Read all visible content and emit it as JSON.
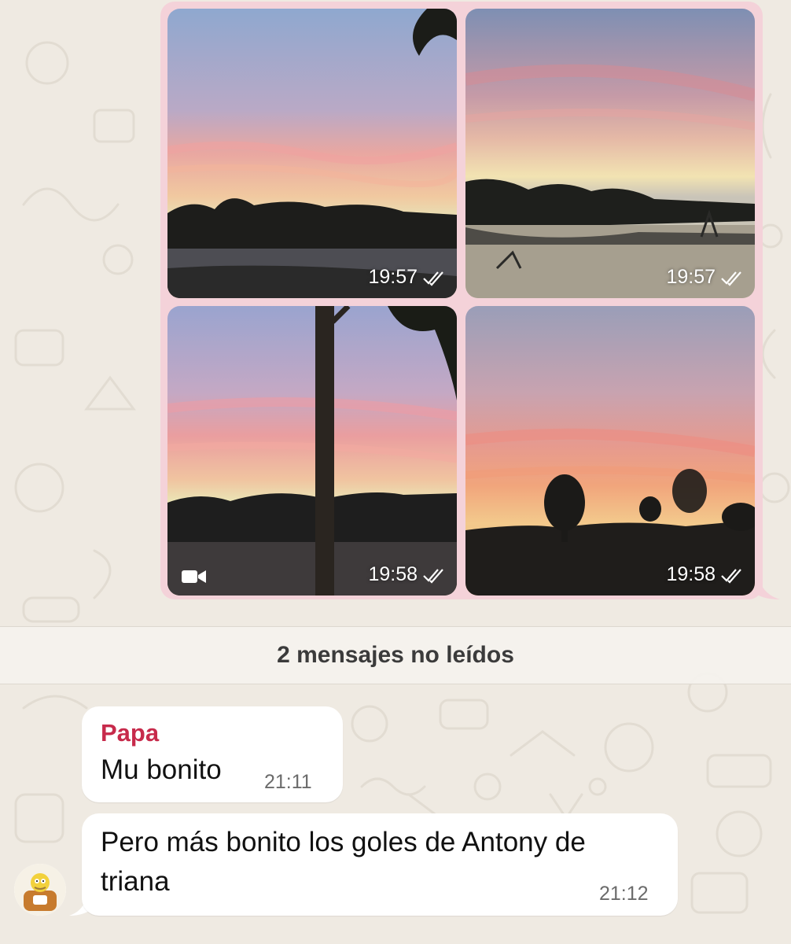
{
  "media_group": {
    "photos": [
      {
        "time": "19:57",
        "status": "read-checks-icon"
      },
      {
        "time": "19:57",
        "status": "read-checks-icon"
      },
      {
        "time": "19:58",
        "status": "read-checks-icon",
        "type_icon": "video-camera-icon"
      },
      {
        "time": "19:58",
        "status": "read-checks-icon"
      }
    ]
  },
  "unread_divider": {
    "label": "2 mensajes no leídos"
  },
  "messages": [
    {
      "sender": "Papa",
      "text": "Mu bonito",
      "time": "21:11"
    },
    {
      "text_line1": "Pero más bonito los goles de Antony de",
      "text_line2": "triana",
      "time": "21:12",
      "avatar_icon": "cartoon-avatar-icon"
    }
  ],
  "colors": {
    "outgoing_bubble": "#f4d2d9",
    "incoming_bubble": "#ffffff",
    "sender_name": "#c72a4b",
    "wallpaper": "#efeae2"
  }
}
